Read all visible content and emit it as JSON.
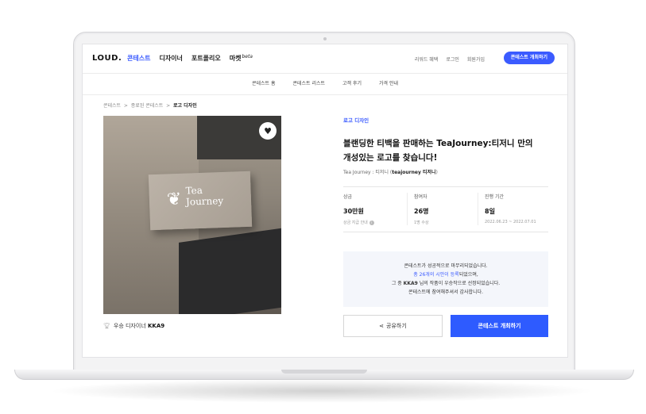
{
  "nav": {
    "logo": "LOUD.",
    "menu": [
      "콘테스트",
      "디자이너",
      "포트폴리오",
      "마켓"
    ],
    "market_badge": "beta",
    "right_links": [
      "리워드 혜택",
      "로그인",
      "회원가입"
    ],
    "host_button": "콘테스트 개최하기"
  },
  "subnav": [
    "콘테스트 홈",
    "콘테스트 리스트",
    "고객 후기",
    "가격 안내"
  ],
  "breadcrumb": {
    "level1": "콘테스트",
    "level2": "종료된 콘테스트",
    "current": "로고 디자인",
    "separator": ">"
  },
  "photo": {
    "sign_line1": "Tea",
    "sign_line2": "Journey"
  },
  "winner": {
    "label": "우승 디자이너",
    "name": "KKA9"
  },
  "contest": {
    "category": "로고 디자인",
    "title_line1": "블랜딩한 티백을 판매하는 TeaJourney:티저니 만의",
    "title_line2": "개성있는 로고를 찾습니다!",
    "client_prefix": "Tea Journey : 티저니 (",
    "client_name": "teajourney 티저니",
    "client_suffix": ")"
  },
  "stats": [
    {
      "label": "상금",
      "value": "30만원",
      "note": "상금 지급 안내"
    },
    {
      "label": "참여자",
      "value": "26명",
      "note": "1명 수상"
    },
    {
      "label": "진행 기간",
      "value": "8일",
      "note": "2022.06.23 ~ 2022.07.01"
    }
  ],
  "notice": {
    "line1": "콘테스트가 성공적으로 마무리되었습니다.",
    "line2_blue": "총 26개의 시안이 등록",
    "line2_rest": "되었으며,",
    "line3_prefix": "그 중 ",
    "line3_name": "KKA9",
    "line3_rest": " 님의 작품이 우승작으로 선정되었습니다.",
    "line4": "콘테스트에 참여해주셔서 감사합니다."
  },
  "buttons": {
    "share": "공유하기",
    "host": "콘테스트 개최하기"
  },
  "colors": {
    "accent": "#3b5bff",
    "notice_bg": "#f4f6fb"
  }
}
